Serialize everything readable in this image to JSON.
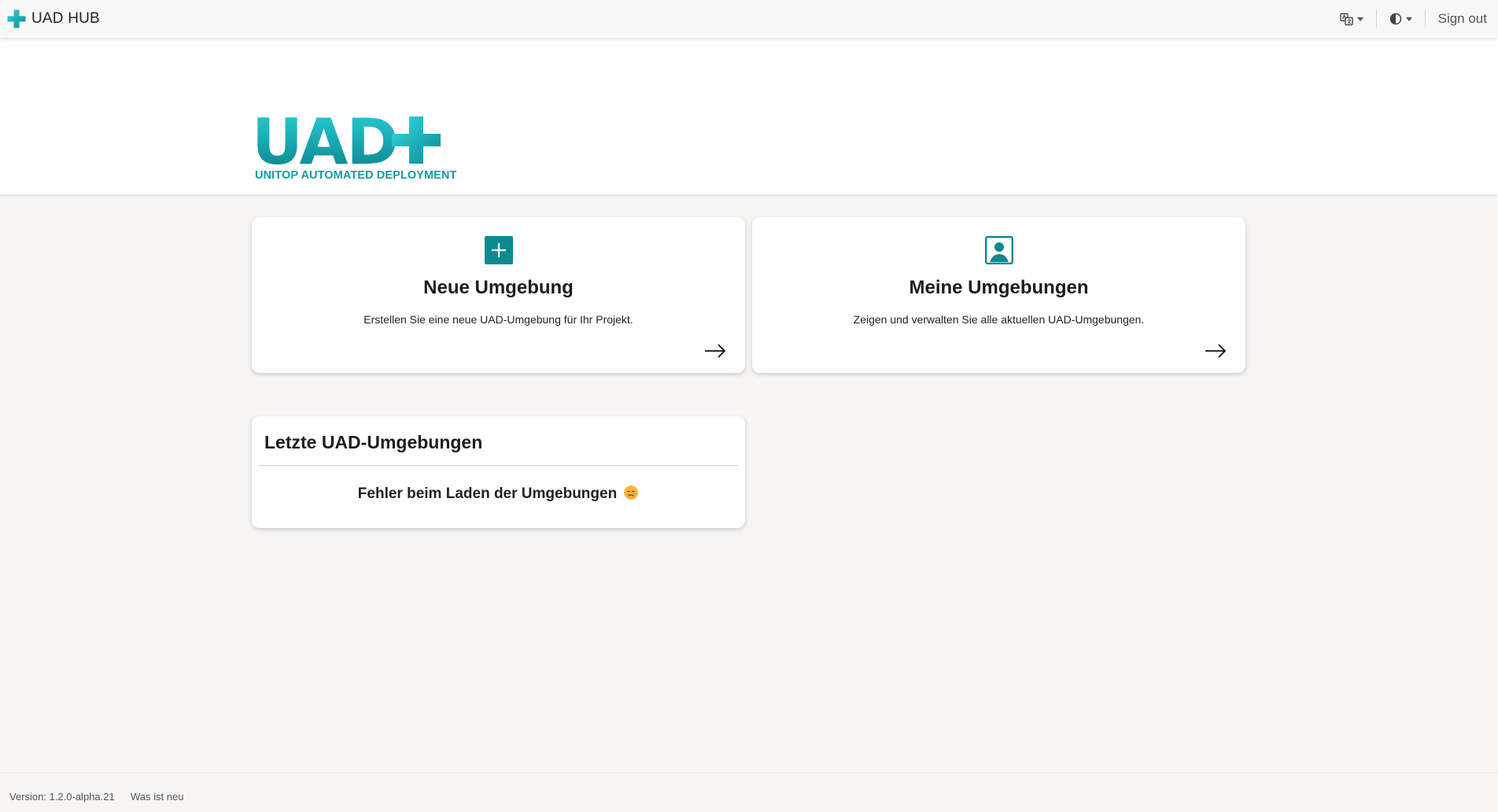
{
  "header": {
    "brand": "UAD HUB",
    "sign_out": "Sign out",
    "icons": [
      "plus-logo-icon",
      "translate-icon",
      "theme-contrast-icon",
      "chevron-down-icon"
    ]
  },
  "hero": {
    "logo_text": "UAD",
    "logo_subtitle": "UNITOP AUTOMATED DEPLOYMENT"
  },
  "cards": {
    "new_env": {
      "title": "Neue Umgebung",
      "description": "Erstellen Sie eine neue UAD-Umgebung für Ihr Projekt.",
      "icon": "plus-square-icon"
    },
    "my_envs": {
      "title": "Meine Umgebungen",
      "description": "Zeigen und verwalten Sie alle aktuellen UAD-Umgebungen.",
      "icon": "person-badge-icon"
    }
  },
  "recent": {
    "title": "Letzte UAD-Umgebungen",
    "error": "Fehler beim Laden der Umgebungen"
  },
  "footer": {
    "version": "Version: 1.2.0-alpha.21",
    "whats_new": "Was ist neu"
  },
  "colors": {
    "brand_teal": "#0c8a8f",
    "logo_gradient_start": "#27d0d7",
    "logo_gradient_end": "#0a7f8a",
    "page_bg": "#f6f5f4"
  }
}
